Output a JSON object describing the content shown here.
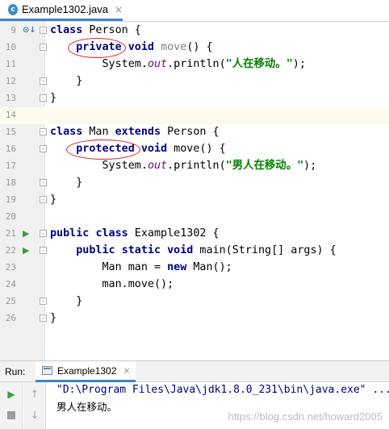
{
  "editor_tab": {
    "file_name": "Example1302.java",
    "icon": "java-class-icon",
    "close": "×"
  },
  "editor": {
    "line_numbers": [
      "9",
      "10",
      "11",
      "12",
      "13",
      "14",
      "15",
      "16",
      "17",
      "18",
      "19",
      "20",
      "21",
      "22",
      "23",
      "24",
      "25",
      "26"
    ],
    "lines": [
      {
        "num": "9",
        "t": [
          {
            "c": "kw",
            "v": "class"
          },
          {
            "c": "",
            "v": " Person {"
          }
        ]
      },
      {
        "num": "10",
        "t": [
          {
            "c": "",
            "v": "    "
          },
          {
            "c": "kw",
            "v": "private"
          },
          {
            "c": "",
            "v": " "
          },
          {
            "c": "kw",
            "v": "void"
          },
          {
            "c": "",
            "v": " "
          },
          {
            "c": "gray",
            "v": "move"
          },
          {
            "c": "",
            "v": "() {"
          }
        ]
      },
      {
        "num": "11",
        "t": [
          {
            "c": "",
            "v": "        System."
          },
          {
            "c": "fld",
            "v": "out"
          },
          {
            "c": "",
            "v": ".println("
          },
          {
            "c": "str",
            "v": "\"人在移动。\""
          },
          {
            "c": "",
            "v": ");"
          }
        ]
      },
      {
        "num": "12",
        "t": [
          {
            "c": "",
            "v": "    }"
          }
        ]
      },
      {
        "num": "13",
        "t": [
          {
            "c": "",
            "v": "}"
          }
        ]
      },
      {
        "num": "14",
        "t": []
      },
      {
        "num": "15",
        "t": [
          {
            "c": "kw",
            "v": "class"
          },
          {
            "c": "",
            "v": " Man "
          },
          {
            "c": "kw",
            "v": "extends"
          },
          {
            "c": "",
            "v": " Person {"
          }
        ]
      },
      {
        "num": "16",
        "t": [
          {
            "c": "",
            "v": "    "
          },
          {
            "c": "kw",
            "v": "protected"
          },
          {
            "c": "",
            "v": " "
          },
          {
            "c": "kw",
            "v": "void"
          },
          {
            "c": "",
            "v": " move() {"
          }
        ]
      },
      {
        "num": "17",
        "t": [
          {
            "c": "",
            "v": "        System."
          },
          {
            "c": "fld",
            "v": "out"
          },
          {
            "c": "",
            "v": ".println("
          },
          {
            "c": "str",
            "v": "\"男人在移动。\""
          },
          {
            "c": "",
            "v": ");"
          }
        ]
      },
      {
        "num": "18",
        "t": [
          {
            "c": "",
            "v": "    }"
          }
        ]
      },
      {
        "num": "19",
        "t": [
          {
            "c": "",
            "v": "}"
          }
        ]
      },
      {
        "num": "20",
        "t": []
      },
      {
        "num": "21",
        "t": [
          {
            "c": "kw",
            "v": "public"
          },
          {
            "c": "",
            "v": " "
          },
          {
            "c": "kw",
            "v": "class"
          },
          {
            "c": "",
            "v": " Example1302 {"
          }
        ]
      },
      {
        "num": "22",
        "t": [
          {
            "c": "",
            "v": "    "
          },
          {
            "c": "kw",
            "v": "public"
          },
          {
            "c": "",
            "v": " "
          },
          {
            "c": "kw",
            "v": "static"
          },
          {
            "c": "",
            "v": " "
          },
          {
            "c": "kw",
            "v": "void"
          },
          {
            "c": "",
            "v": " main(String[] args) {"
          }
        ]
      },
      {
        "num": "23",
        "t": [
          {
            "c": "",
            "v": "        Man man = "
          },
          {
            "c": "kw",
            "v": "new"
          },
          {
            "c": "",
            "v": " Man();"
          }
        ]
      },
      {
        "num": "24",
        "t": [
          {
            "c": "",
            "v": "        man.move();"
          }
        ]
      },
      {
        "num": "25",
        "t": [
          {
            "c": "",
            "v": "    }"
          }
        ]
      },
      {
        "num": "26",
        "t": [
          {
            "c": "",
            "v": "}"
          }
        ]
      }
    ]
  },
  "run_panel": {
    "label": "Run:",
    "tab_name": "Example1302",
    "tab_close": "×",
    "console": {
      "command": "\"D:\\Program Files\\Java\\jdk1.8.0_231\\bin\\java.exe\" ...",
      "output": "男人在移动。"
    },
    "watermark": "https://blog.csdn.net/howard2005"
  },
  "colors": {
    "keyword": "#000080",
    "string": "#008000",
    "field": "#660e7a",
    "annotation_ellipse": "#e02020",
    "accent_tab": "#4083c9"
  }
}
